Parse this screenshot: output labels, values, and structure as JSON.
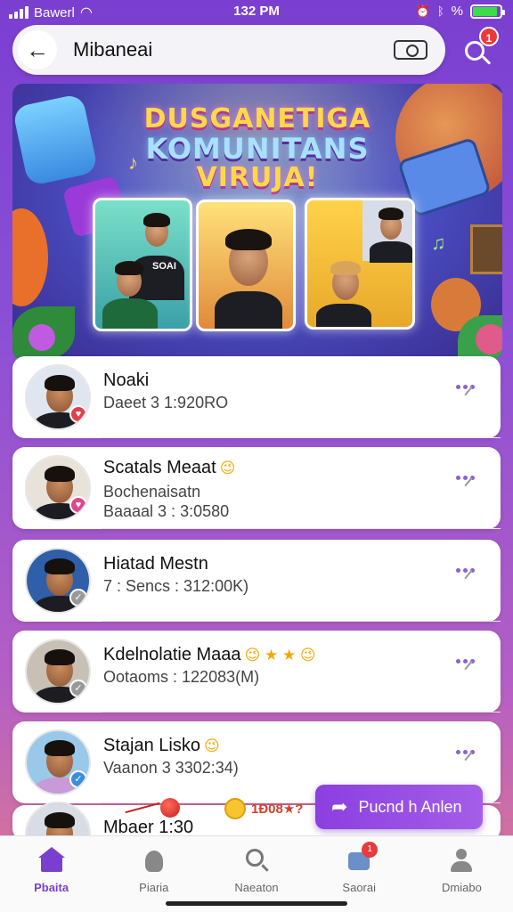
{
  "status_bar": {
    "carrier": "Bawerl",
    "time": "132 PM",
    "battery_percent_label": "%",
    "battery_level": 0.9,
    "colors": {
      "battery": "#3ddc4a"
    }
  },
  "header": {
    "title": "Mibaneai",
    "back_icon": "arrow-left-icon",
    "camera_icon": "camera-icon",
    "search_icon": "user-search-icon",
    "notification_count": "1"
  },
  "banner": {
    "title_line1": "DUSGANETIGA",
    "title_line2": "KOMUNITANS",
    "title_line3": "VIRUJA!",
    "overlay_text": "SOAI"
  },
  "contacts": [
    {
      "name": "Noaki",
      "line1": "Daeet 3 1:920RO",
      "line2": "",
      "emojis": "",
      "badge_color": "#e0404a",
      "badge_icon": "♥"
    },
    {
      "name": "Scatals Meaat",
      "line1": "Bochenaisatn",
      "line2": "Baaaal 3 : 3:0580",
      "emojis": "😉",
      "badge_color": "#d84a8c",
      "badge_icon": "♥"
    },
    {
      "name": "Hiatad Mestn",
      "line1": "7 : Sencs : 312:00K)",
      "line2": "",
      "emojis": "",
      "badge_color": "#999999",
      "badge_icon": "✓"
    },
    {
      "name": "Kdelnolatie Maaa",
      "line1": "Ootaoms : 122083(M)",
      "line2": "",
      "emojis": "😉 ★ ★ 😉",
      "badge_color": "#999999",
      "badge_icon": "✓"
    },
    {
      "name": "Stajan Lisko",
      "line1": "Vaanon 3 3302:34)",
      "line2": "",
      "emojis": "😉",
      "badge_color": "#3a8ee0",
      "badge_icon": "✓"
    },
    {
      "name": "Mbaer 1:30",
      "line1": "",
      "line2": "",
      "emojis": "",
      "badge_color": "#999999",
      "badge_icon": ""
    }
  ],
  "promo": {
    "label": "1Ð08★?"
  },
  "fab": {
    "label": "Pucnd h Anlen",
    "icon": "share-arrow-icon"
  },
  "bottom_nav": [
    {
      "label": "Pbaita",
      "icon": "home-icon",
      "active": true
    },
    {
      "label": "Piaria",
      "icon": "people-icon",
      "active": false
    },
    {
      "label": "Naeaton",
      "icon": "search-icon",
      "active": false
    },
    {
      "label": "Saorai",
      "icon": "chat-icon",
      "active": false,
      "badge": "1"
    },
    {
      "label": "Dmiabo",
      "icon": "profile-icon",
      "active": false
    }
  ],
  "colors": {
    "accent": "#7a3fd0",
    "badge_red": "#e83a3a",
    "fab_start": "#8b3fe0"
  }
}
